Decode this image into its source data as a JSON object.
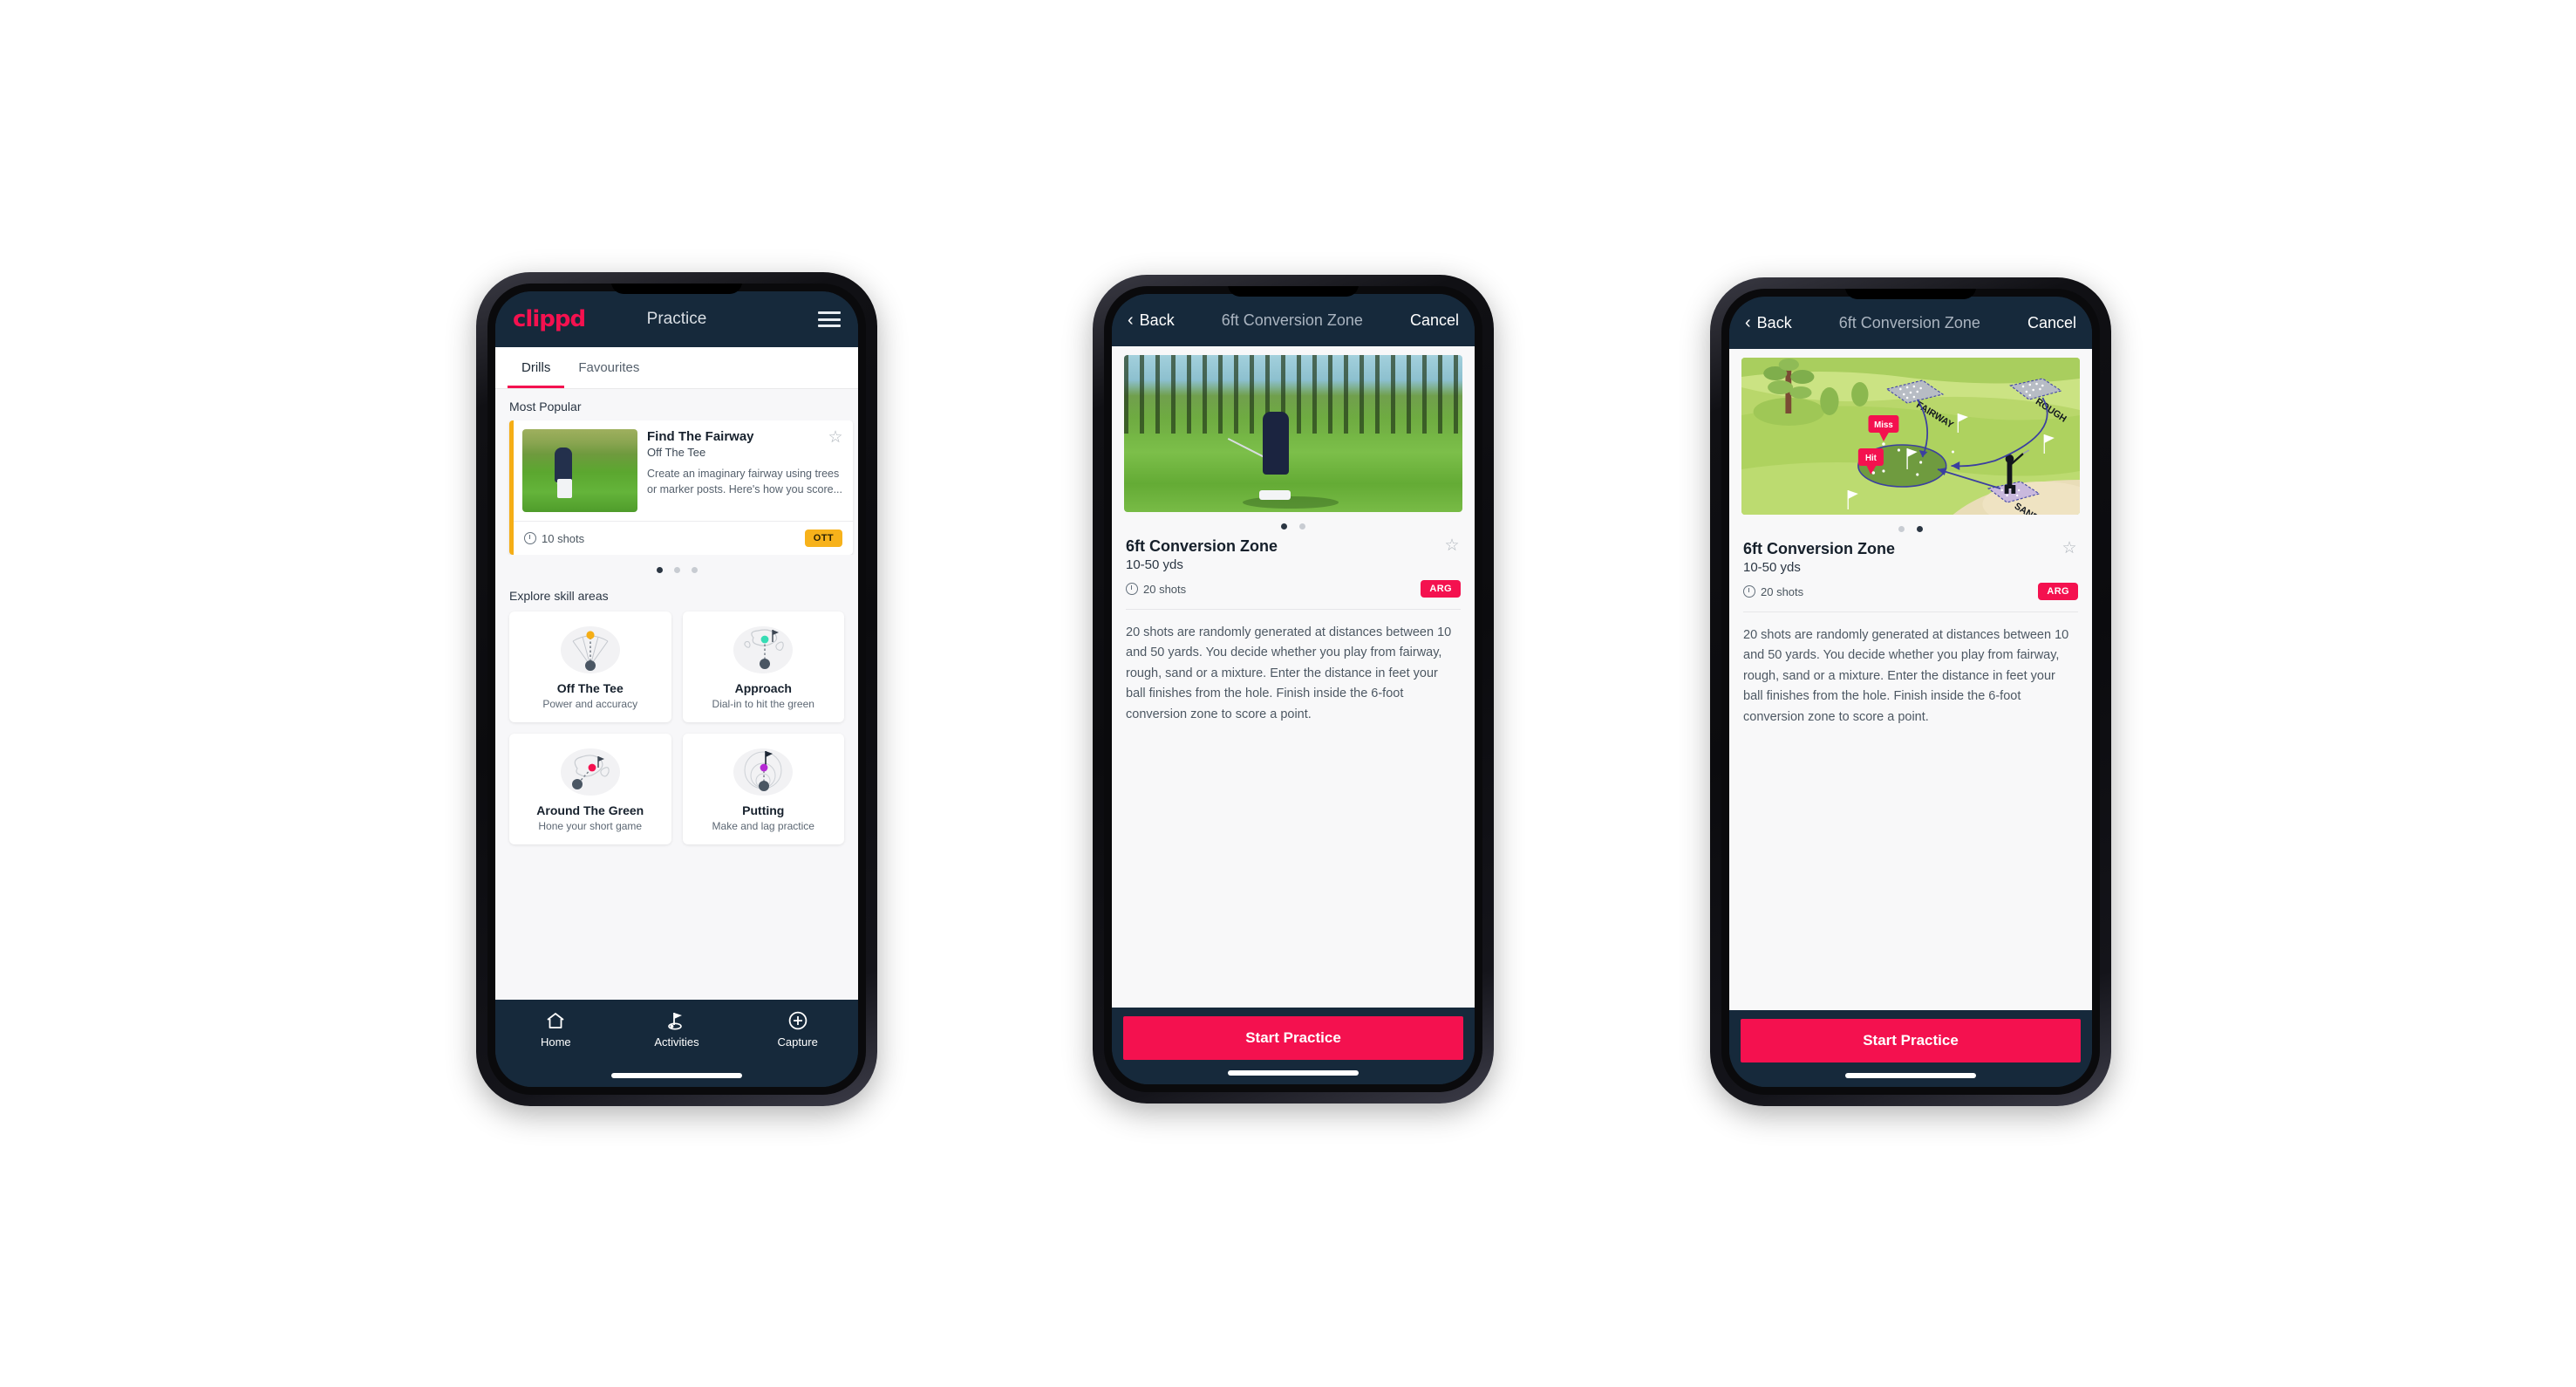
{
  "phone1": {
    "appbar": {
      "logo": "clippd",
      "title": "Practice",
      "menu_icon": "hamburger-icon"
    },
    "tabs": [
      {
        "label": "Drills",
        "active": true
      },
      {
        "label": "Favourites",
        "active": false
      }
    ],
    "sections": {
      "most_popular_label": "Most Popular",
      "explore_label": "Explore skill areas"
    },
    "featured_drill": {
      "title": "Find The Fairway",
      "subtitle": "Off The Tee",
      "description": "Create an imaginary fairway using trees or marker posts. Here's how you score...",
      "shots": "10 shots",
      "tag": "OTT",
      "tag_color": "#f7b21b",
      "accent_color": "#f5ae16",
      "favourite_icon": "star-outline-icon"
    },
    "carousel_dots": {
      "count": 3,
      "active_index": 0
    },
    "skill_areas": [
      {
        "name": "Off The Tee",
        "desc": "Power and accuracy",
        "icon": "off-the-tee-fan-icon",
        "color": "#f5ae16"
      },
      {
        "name": "Approach",
        "desc": "Dial-in to hit the green",
        "icon": "approach-green-icon",
        "color": "#35dcb4"
      },
      {
        "name": "Around The Green",
        "desc": "Hone your short game",
        "icon": "around-the-green-icon",
        "color": "#f4114f"
      },
      {
        "name": "Putting",
        "desc": "Make and lag practice",
        "icon": "putting-rings-icon",
        "color": "#b528d4"
      }
    ],
    "bottom_nav": [
      {
        "label": "Home",
        "icon": "home-icon",
        "active": false
      },
      {
        "label": "Activities",
        "icon": "golf-flag-icon",
        "active": true
      },
      {
        "label": "Capture",
        "icon": "plus-circle-icon",
        "active": false
      }
    ]
  },
  "phone2": {
    "navbar": {
      "back": "Back",
      "title": "6ft Conversion Zone",
      "cancel": "Cancel",
      "back_icon": "chevron-left-icon"
    },
    "media": {
      "type": "photo",
      "alt": "golfer-chipping-photo"
    },
    "carousel_dots": {
      "count": 2,
      "active_index": 0
    },
    "detail": {
      "title": "6ft Conversion Zone",
      "subtitle": "10-50 yds",
      "shots": "20 shots",
      "tag": "ARG",
      "tag_color": "#f4114f",
      "favourite_icon": "star-outline-icon",
      "description": "20 shots are randomly generated at distances between 10 and 50 yards. You decide whether you play from fairway, rough, sand or a mixture. Enter the distance in feet your ball finishes from the hole. Finish inside the 6-foot conversion zone to score a point."
    },
    "cta": "Start Practice"
  },
  "phone3": {
    "navbar": {
      "back": "Back",
      "title": "6ft Conversion Zone",
      "cancel": "Cancel",
      "back_icon": "chevron-left-icon"
    },
    "media": {
      "type": "illustration",
      "alt": "golf-course-diagram",
      "labels": {
        "fairway": "FAIRWAY",
        "rough": "ROUGH",
        "sand": "SAND",
        "miss": "Miss",
        "hit": "Hit"
      }
    },
    "carousel_dots": {
      "count": 2,
      "active_index": 1
    },
    "detail": {
      "title": "6ft Conversion Zone",
      "subtitle": "10-50 yds",
      "shots": "20 shots",
      "tag": "ARG",
      "tag_color": "#f4114f",
      "favourite_icon": "star-outline-icon",
      "description": "20 shots are randomly generated at distances between 10 and 50 yards. You decide whether you play from fairway, rough, sand or a mixture. Enter the distance in feet your ball finishes from the hole. Finish inside the 6-foot conversion zone to score a point."
    },
    "cta": "Start Practice"
  }
}
